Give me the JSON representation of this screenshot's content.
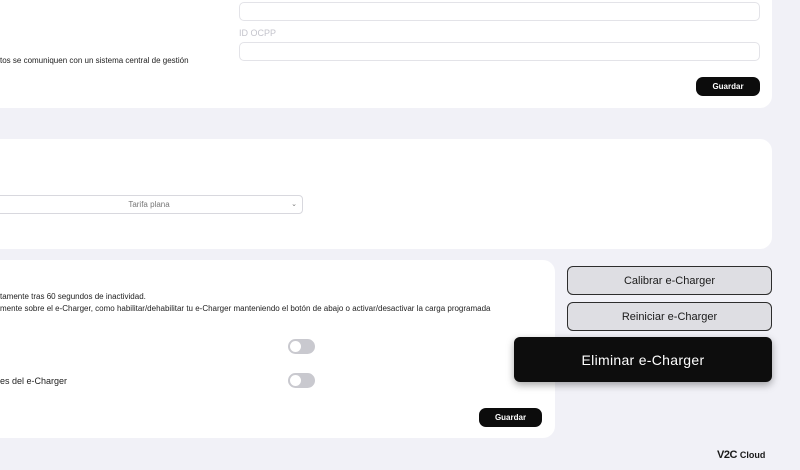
{
  "ocpp_card": {
    "id_label": "ID OCPP",
    "description": "tos se comuniquen con un sistema central de gestión",
    "save_label": "Guardar"
  },
  "tariff_card": {
    "tariff_selected": "Tarifa plana"
  },
  "settings_card": {
    "line1": "tamente tras 60 segundos de inactividad.",
    "line2": "mente sobre el e-Charger, como habilitar/dehabilitar tu e-Charger manteniendo el botón de abajo o activar/desactivar la carga programada",
    "toggle2_label": "es del e-Charger",
    "save_label": "Guardar",
    "toggles": [
      false,
      false
    ]
  },
  "actions": {
    "calibrate_label": "Calibrar e-Charger",
    "restart_label": "Reiniciar e-Charger",
    "delete_label": "Eliminar e-Charger"
  },
  "footer": {
    "logo_mark": "V2C",
    "logo_sub": "Cloud"
  }
}
